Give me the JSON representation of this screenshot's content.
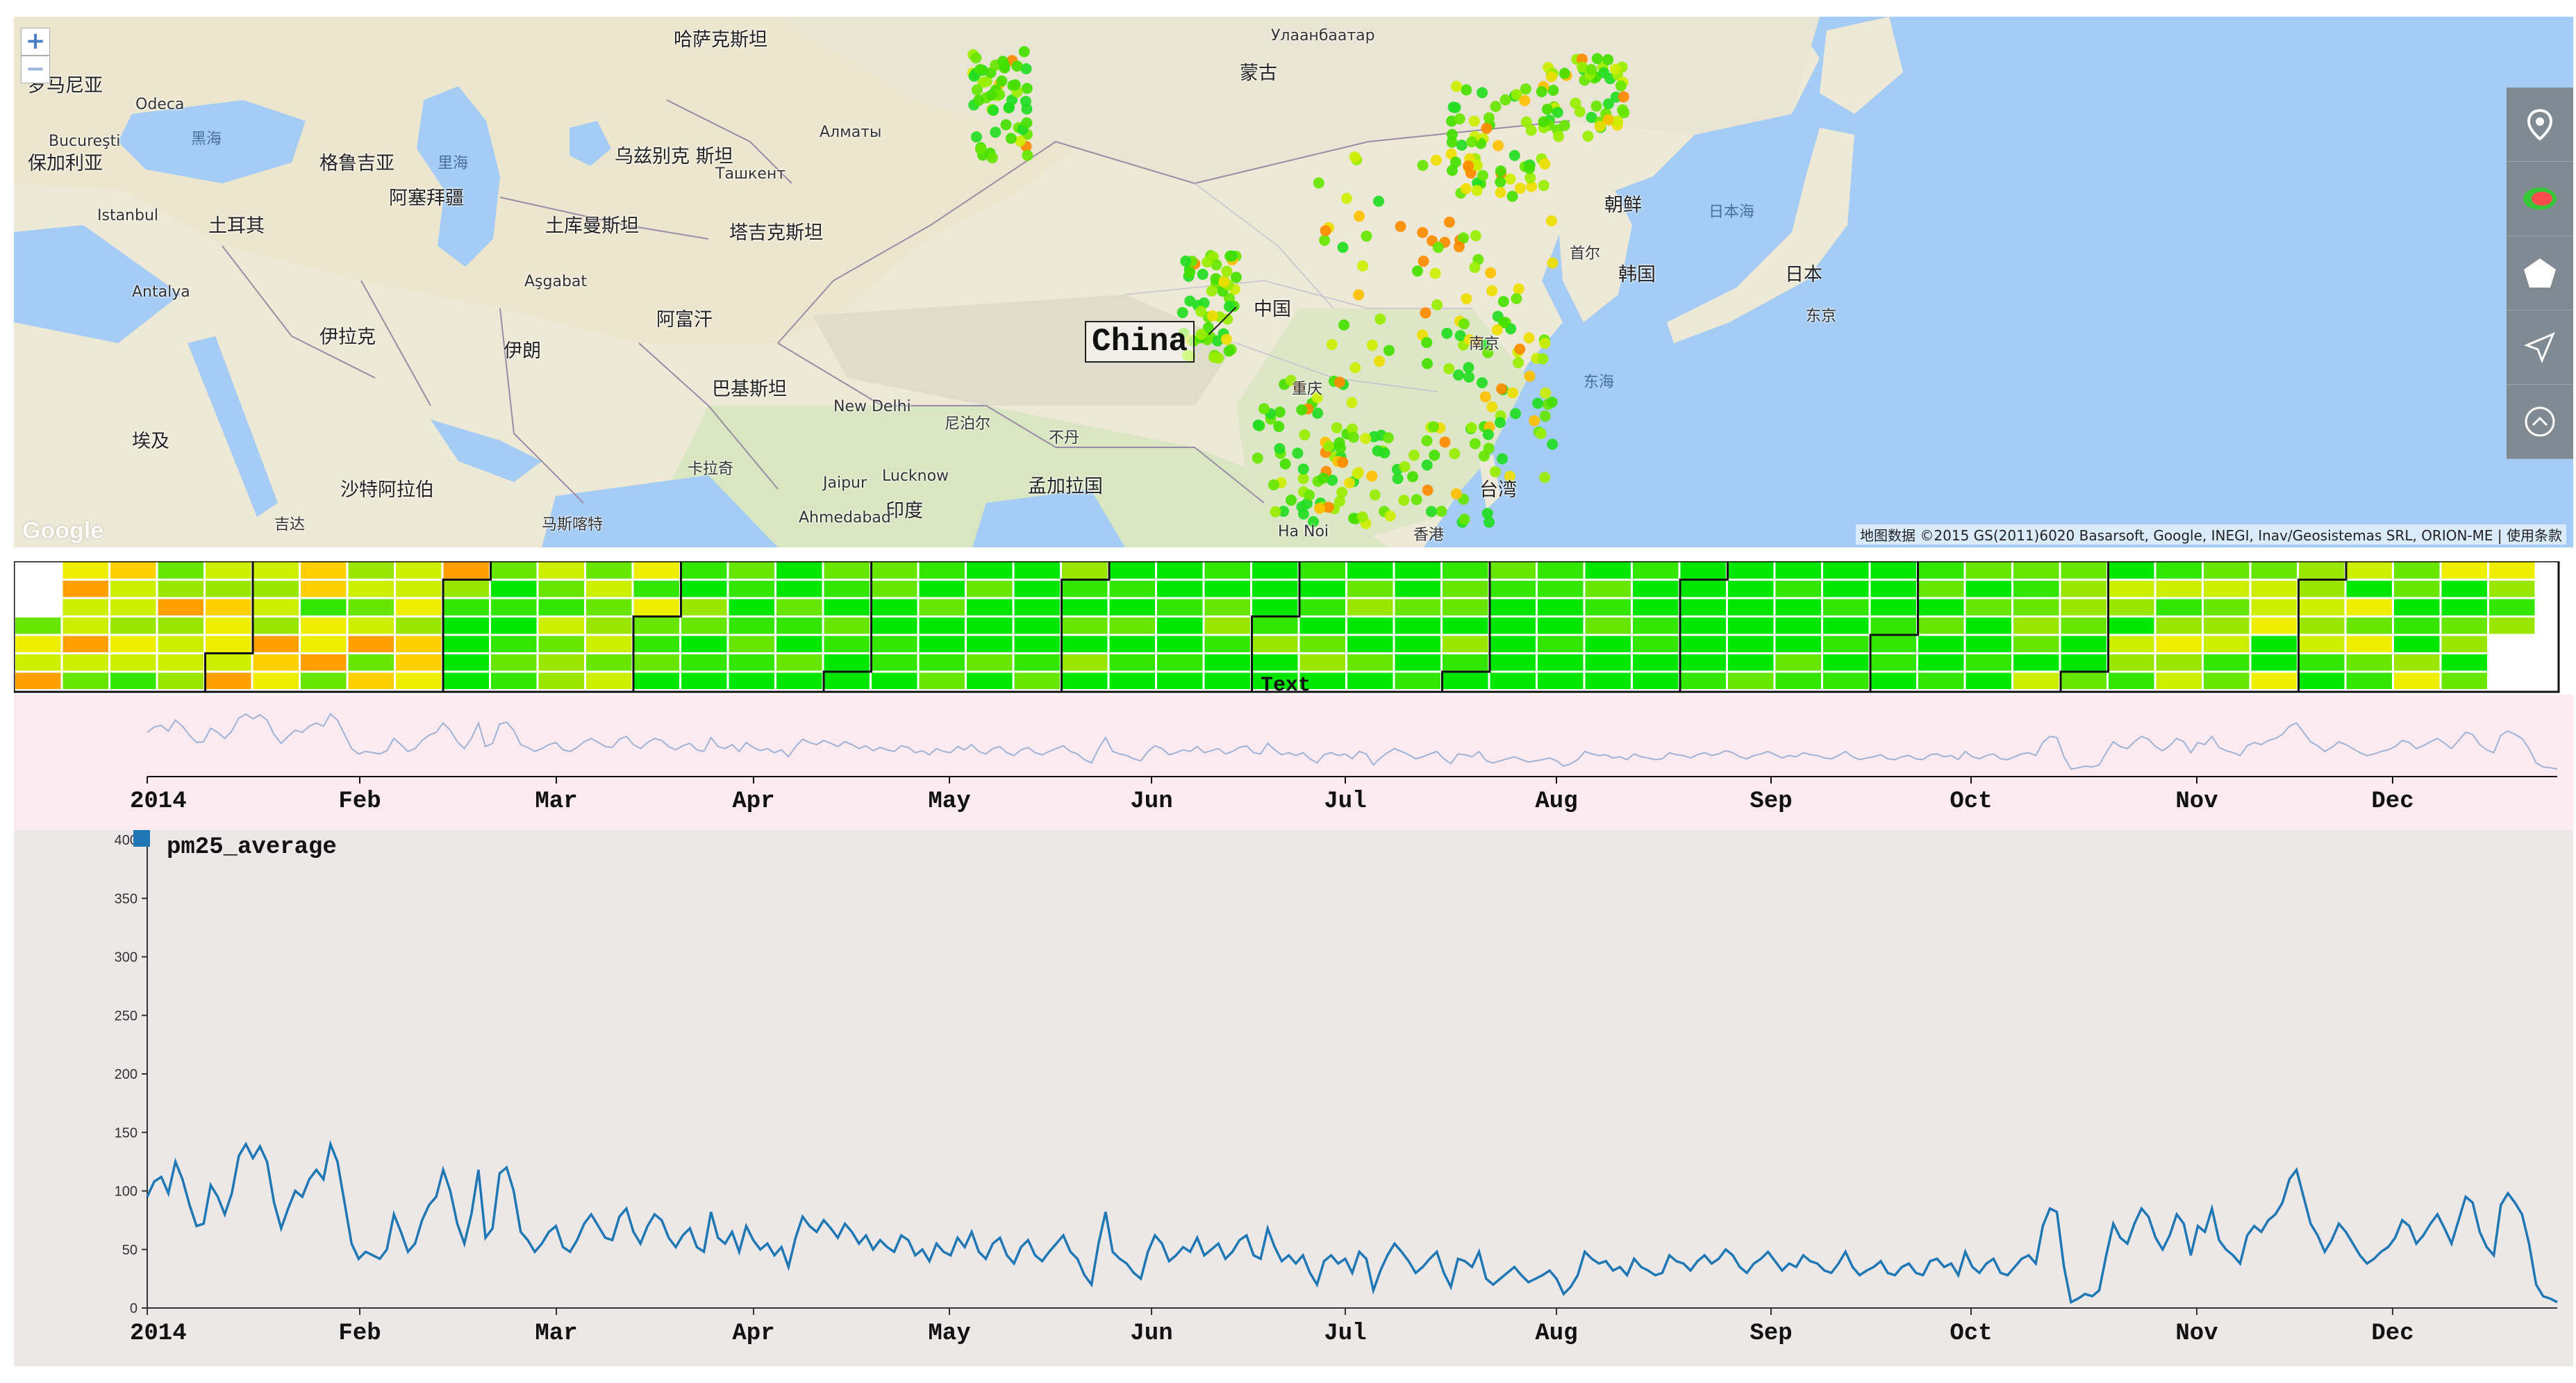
{
  "map": {
    "highlighted_country": "China",
    "attribution": "地图数据 ©2015 GS(2011)6020 Basarsoft, Google, INEGI, Inav/Geosistemas SRL, ORION-ME | 使用条款",
    "google_logo": "Google",
    "zoom_in_label": "+",
    "zoom_out_label": "−",
    "labels": [
      {
        "text": "哈萨克斯坦",
        "x": 950,
        "y": 22,
        "cls": "big"
      },
      {
        "text": "蒙古",
        "x": 1765,
        "y": 70,
        "cls": "big"
      },
      {
        "text": "Улаанбаатар",
        "x": 1810,
        "y": 16,
        "cls": ""
      },
      {
        "text": "乌兹别克\n斯坦",
        "x": 865,
        "y": 190,
        "cls": "big"
      },
      {
        "text": "土库曼斯坦",
        "x": 765,
        "y": 290,
        "cls": "big"
      },
      {
        "text": "塔吉克斯坦",
        "x": 1030,
        "y": 300,
        "cls": "big"
      },
      {
        "text": "阿富汗",
        "x": 925,
        "y": 425,
        "cls": "big"
      },
      {
        "text": "巴基斯坦",
        "x": 1005,
        "y": 525,
        "cls": "big"
      },
      {
        "text": "伊朗",
        "x": 705,
        "y": 470,
        "cls": "big"
      },
      {
        "text": "伊拉克",
        "x": 440,
        "y": 450,
        "cls": "big"
      },
      {
        "text": "土耳其",
        "x": 280,
        "y": 290,
        "cls": "big"
      },
      {
        "text": "阿塞拜疆",
        "x": 540,
        "y": 250,
        "cls": "big"
      },
      {
        "text": "格鲁吉亚",
        "x": 440,
        "y": 200,
        "cls": "big"
      },
      {
        "text": "沙特阿拉伯",
        "x": 470,
        "y": 670,
        "cls": "big"
      },
      {
        "text": "埃及",
        "x": 170,
        "y": 600,
        "cls": "big"
      },
      {
        "text": "保加利亚",
        "x": 20,
        "y": 200,
        "cls": "big"
      },
      {
        "text": "罗马尼亚",
        "x": 20,
        "y": 88,
        "cls": "big"
      },
      {
        "text": "印度",
        "x": 1255,
        "y": 700,
        "cls": "big"
      },
      {
        "text": "尼泊尔",
        "x": 1340,
        "y": 575,
        "cls": ""
      },
      {
        "text": "不丹",
        "x": 1490,
        "y": 595,
        "cls": ""
      },
      {
        "text": "孟加拉国",
        "x": 1460,
        "y": 665,
        "cls": "big"
      },
      {
        "text": "中国",
        "x": 1785,
        "y": 410,
        "cls": "big"
      },
      {
        "text": "朝鲜",
        "x": 2290,
        "y": 260,
        "cls": "big"
      },
      {
        "text": "韩国",
        "x": 2310,
        "y": 360,
        "cls": "big"
      },
      {
        "text": "日本",
        "x": 2550,
        "y": 360,
        "cls": "big"
      },
      {
        "text": "日本海",
        "x": 2440,
        "y": 270,
        "cls": "sea"
      },
      {
        "text": "东海",
        "x": 2260,
        "y": 515,
        "cls": "sea"
      },
      {
        "text": "黑海",
        "x": 255,
        "y": 165,
        "cls": "sea"
      },
      {
        "text": "里海",
        "x": 610,
        "y": 200,
        "cls": "sea"
      },
      {
        "text": "台湾",
        "x": 2110,
        "y": 670,
        "cls": "big"
      },
      {
        "text": "香港",
        "x": 2015,
        "y": 735,
        "cls": ""
      },
      {
        "text": "南京",
        "x": 2095,
        "y": 460,
        "cls": ""
      },
      {
        "text": "重庆",
        "x": 1840,
        "y": 525,
        "cls": ""
      },
      {
        "text": "New Delhi",
        "x": 1180,
        "y": 550,
        "cls": ""
      },
      {
        "text": "Lucknow",
        "x": 1250,
        "y": 650,
        "cls": ""
      },
      {
        "text": "Ahmedabad",
        "x": 1130,
        "y": 710,
        "cls": ""
      },
      {
        "text": "Ha Noi",
        "x": 1820,
        "y": 730,
        "cls": ""
      },
      {
        "text": "Istanbul",
        "x": 120,
        "y": 275,
        "cls": ""
      },
      {
        "text": "Odeca",
        "x": 175,
        "y": 115,
        "cls": ""
      },
      {
        "text": "Bucureşti",
        "x": 50,
        "y": 168,
        "cls": ""
      },
      {
        "text": "Алматы",
        "x": 1160,
        "y": 155,
        "cls": ""
      },
      {
        "text": "Ташкент",
        "x": 1010,
        "y": 215,
        "cls": ""
      },
      {
        "text": "Aşgabat",
        "x": 735,
        "y": 370,
        "cls": ""
      },
      {
        "text": "Antalya",
        "x": 170,
        "y": 385,
        "cls": ""
      },
      {
        "text": "Jaipur",
        "x": 1165,
        "y": 660,
        "cls": ""
      },
      {
        "text": "吉达",
        "x": 375,
        "y": 720,
        "cls": ""
      },
      {
        "text": "卡拉奇",
        "x": 970,
        "y": 640,
        "cls": ""
      },
      {
        "text": "马斯喀特",
        "x": 760,
        "y": 720,
        "cls": ""
      },
      {
        "text": "首尔",
        "x": 2240,
        "y": 330,
        "cls": ""
      },
      {
        "text": "东京",
        "x": 2580,
        "y": 420,
        "cls": ""
      }
    ],
    "toolbar": [
      {
        "name": "marker-tool-icon"
      },
      {
        "name": "heatmap-tool-icon"
      },
      {
        "name": "polygon-tool-icon"
      },
      {
        "name": "navigate-tool-icon"
      },
      {
        "name": "collapse-tool-icon"
      }
    ]
  },
  "calendar": {
    "label": "Text",
    "colors": [
      "#00e600",
      "#33e600",
      "#66e600",
      "#99e600",
      "#ccee00",
      "#eeee00",
      "#ffd000",
      "#ffa000",
      "#ff8000"
    ]
  },
  "context": {
    "x_ticks": [
      "2014",
      "Feb",
      "Mar",
      "Apr",
      "May",
      "Jun",
      "Jul",
      "Aug",
      "Sep",
      "Oct",
      "Nov",
      "Dec"
    ]
  },
  "chart_data": {
    "type": "line",
    "title": "",
    "series": [
      {
        "name": "pm25_average"
      }
    ],
    "x_ticks": [
      "2014",
      "Feb",
      "Mar",
      "Apr",
      "May",
      "Jun",
      "Jul",
      "Aug",
      "Sep",
      "Oct",
      "Nov",
      "Dec"
    ],
    "y_ticks": [
      "0",
      "50",
      "100",
      "150",
      "200",
      "250",
      "300",
      "350",
      "400"
    ],
    "ylim": [
      0,
      400
    ],
    "x_range": [
      "2014-01-01",
      "2014-12-31"
    ],
    "values": [
      95,
      108,
      112,
      98,
      125,
      110,
      88,
      70,
      72,
      105,
      95,
      80,
      98,
      130,
      140,
      128,
      138,
      125,
      90,
      68,
      85,
      100,
      95,
      110,
      118,
      110,
      140,
      125,
      90,
      55,
      42,
      48,
      45,
      42,
      50,
      80,
      65,
      48,
      55,
      75,
      88,
      95,
      118,
      100,
      72,
      55,
      80,
      118,
      60,
      68,
      115,
      120,
      100,
      65,
      58,
      48,
      55,
      65,
      70,
      52,
      48,
      58,
      72,
      80,
      70,
      60,
      58,
      78,
      85,
      65,
      55,
      70,
      80,
      75,
      60,
      52,
      62,
      68,
      52,
      48,
      82,
      60,
      55,
      65,
      48,
      70,
      58,
      50,
      55,
      45,
      52,
      35,
      60,
      78,
      70,
      65,
      75,
      68,
      60,
      72,
      65,
      55,
      62,
      50,
      58,
      52,
      48,
      62,
      58,
      45,
      50,
      40,
      55,
      48,
      45,
      60,
      52,
      65,
      48,
      42,
      55,
      60,
      45,
      38,
      52,
      58,
      45,
      40,
      48,
      55,
      62,
      48,
      42,
      28,
      20,
      55,
      82,
      48,
      42,
      38,
      30,
      25,
      48,
      62,
      55,
      40,
      45,
      52,
      48,
      60,
      45,
      50,
      55,
      42,
      48,
      58,
      62,
      45,
      42,
      68,
      52,
      40,
      45,
      38,
      45,
      30,
      20,
      40,
      45,
      38,
      42,
      30,
      48,
      42,
      15,
      32,
      45,
      55,
      48,
      40,
      30,
      35,
      42,
      48,
      30,
      18,
      42,
      40,
      35,
      48,
      25,
      20,
      25,
      30,
      35,
      28,
      22,
      25,
      28,
      32,
      25,
      12,
      18,
      28,
      48,
      42,
      38,
      40,
      32,
      35,
      28,
      42,
      35,
      32,
      28,
      30,
      45,
      40,
      38,
      32,
      40,
      45,
      38,
      42,
      50,
      45,
      35,
      30,
      38,
      42,
      48,
      40,
      32,
      38,
      35,
      45,
      40,
      38,
      32,
      30,
      38,
      48,
      35,
      28,
      32,
      35,
      40,
      30,
      28,
      35,
      38,
      30,
      28,
      40,
      42,
      35,
      38,
      28,
      48,
      35,
      30,
      38,
      42,
      30,
      28,
      35,
      42,
      45,
      38,
      70,
      85,
      82,
      35,
      5,
      8,
      12,
      10,
      15,
      45,
      72,
      60,
      55,
      72,
      85,
      78,
      60,
      50,
      62,
      80,
      72,
      45,
      70,
      65,
      85,
      58,
      50,
      45,
      38,
      62,
      70,
      65,
      75,
      80,
      90,
      110,
      118,
      95,
      72,
      62,
      48,
      58,
      72,
      65,
      55,
      45,
      38,
      42,
      48,
      52,
      60,
      75,
      70,
      55,
      62,
      72,
      80,
      68,
      55,
      75,
      95,
      90,
      65,
      52,
      45,
      88,
      98,
      90,
      80,
      55,
      20,
      10,
      8,
      5
    ]
  }
}
